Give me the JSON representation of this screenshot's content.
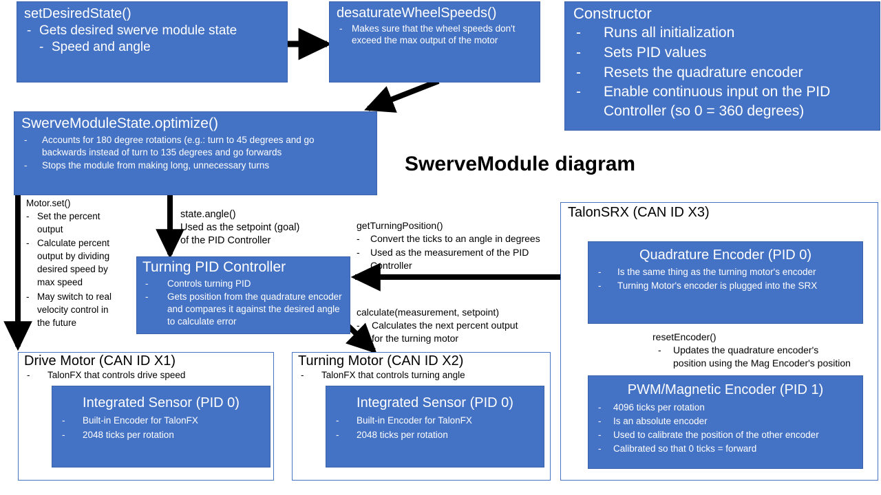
{
  "title": "SwerveModule diagram",
  "colors": {
    "box_fill": "#4472C4",
    "box_outline": "#4472C4",
    "text_on_blue": "#FFFFFF",
    "text_black": "#000000",
    "arrow": "#000000",
    "background": "#FFFFFF"
  },
  "boxes": {
    "set_desired_state": {
      "title": "setDesiredState()",
      "bullets": [
        "Gets desired swerve module state"
      ],
      "sub_bullets": [
        "Speed and angle"
      ]
    },
    "desaturate_wheel_speeds": {
      "title": "desaturateWheelSpeeds()",
      "bullets": [
        "Makes sure that the wheel speeds don't exceed the max output of the motor"
      ]
    },
    "constructor": {
      "title": "Constructor",
      "bullets": [
        "Runs all initialization",
        "Sets PID values",
        "Resets the quadrature encoder",
        "Enable continuous input on the PID Controller (so 0 = 360 degrees)"
      ]
    },
    "optimize": {
      "title": "SwerveModuleState.optimize()",
      "bullets": [
        "Accounts for 180 degree rotations (e.g.: turn to 45 degrees and go backwards instead of turn to 135 degrees and go forwards",
        "Stops the module from making long, unnecessary turns"
      ]
    },
    "turning_pid_controller": {
      "title": "Turning PID Controller",
      "bullets": [
        "Controls turning PID",
        "Gets position from the quadrature encoder and compares it against the desired angle to calculate error"
      ]
    },
    "drive_motor": {
      "title": "Drive Motor (CAN ID X1)",
      "bullets": [
        "TalonFX that controls drive speed"
      ],
      "inner": {
        "title": "Integrated Sensor (PID 0)",
        "bullets": [
          "Built-in Encoder for TalonFX",
          "2048 ticks per rotation"
        ]
      }
    },
    "turning_motor": {
      "title": "Turning Motor (CAN ID X2)",
      "bullets": [
        "TalonFX that controls turning angle"
      ],
      "inner": {
        "title": "Integrated Sensor (PID 0)",
        "bullets": [
          "Built-in Encoder for TalonFX",
          "2048 ticks per rotation"
        ]
      }
    },
    "talon_srx": {
      "title": "TalonSRX (CAN ID X3)",
      "quadrature_encoder": {
        "title": "Quadrature Encoder (PID 0)",
        "bullets": [
          "Is the same thing as the turning motor's encoder",
          "Turning Motor's encoder is plugged into the SRX"
        ]
      },
      "pwm_magnetic_encoder": {
        "title": "PWM/Magnetic Encoder (PID 1)",
        "bullets": [
          "4096 ticks per rotation",
          "Is an absolute encoder",
          "Used to calibrate the position of the other encoder",
          "Calibrated so that 0 ticks = forward"
        ]
      }
    }
  },
  "annotations": {
    "motor_set": {
      "header": "Motor.set()",
      "bullets": [
        "Set the percent output",
        "Calculate percent output by dividing desired speed by max speed",
        "May switch to real velocity control in the future"
      ]
    },
    "state_angle": {
      "header": "state.angle()",
      "lines": [
        "Used as the setpoint (goal)",
        "of the PID Controller"
      ]
    },
    "get_turning_position": {
      "header": "getTurningPosition()",
      "bullets": [
        "Convert the ticks to an angle in degrees",
        "Used as the measurement of the PID Controller"
      ]
    },
    "calculate": {
      "header": "calculate(measurement, setpoint)",
      "bullets": [
        "Calculates the next percent output for the turning motor"
      ]
    },
    "reset_encoder": {
      "header": "resetEncoder()",
      "bullets": [
        "Updates the quadrature encoder's position using the Mag Encoder's position"
      ]
    }
  },
  "arrows": [
    {
      "name": "arrow-setdesiredstate-to-desaturate",
      "direction": "right"
    },
    {
      "name": "arrow-desaturate-to-optimize",
      "direction": "down-left"
    },
    {
      "name": "arrow-optimize-to-drive-motor",
      "direction": "down"
    },
    {
      "name": "arrow-optimize-to-turning-pid",
      "direction": "down"
    },
    {
      "name": "arrow-quadrature-encoder-to-turning-pid",
      "direction": "left"
    },
    {
      "name": "arrow-turning-pid-to-turning-motor",
      "direction": "down-right"
    },
    {
      "name": "arrow-pwm-encoder-to-quadrature-encoder",
      "direction": "up"
    }
  ]
}
